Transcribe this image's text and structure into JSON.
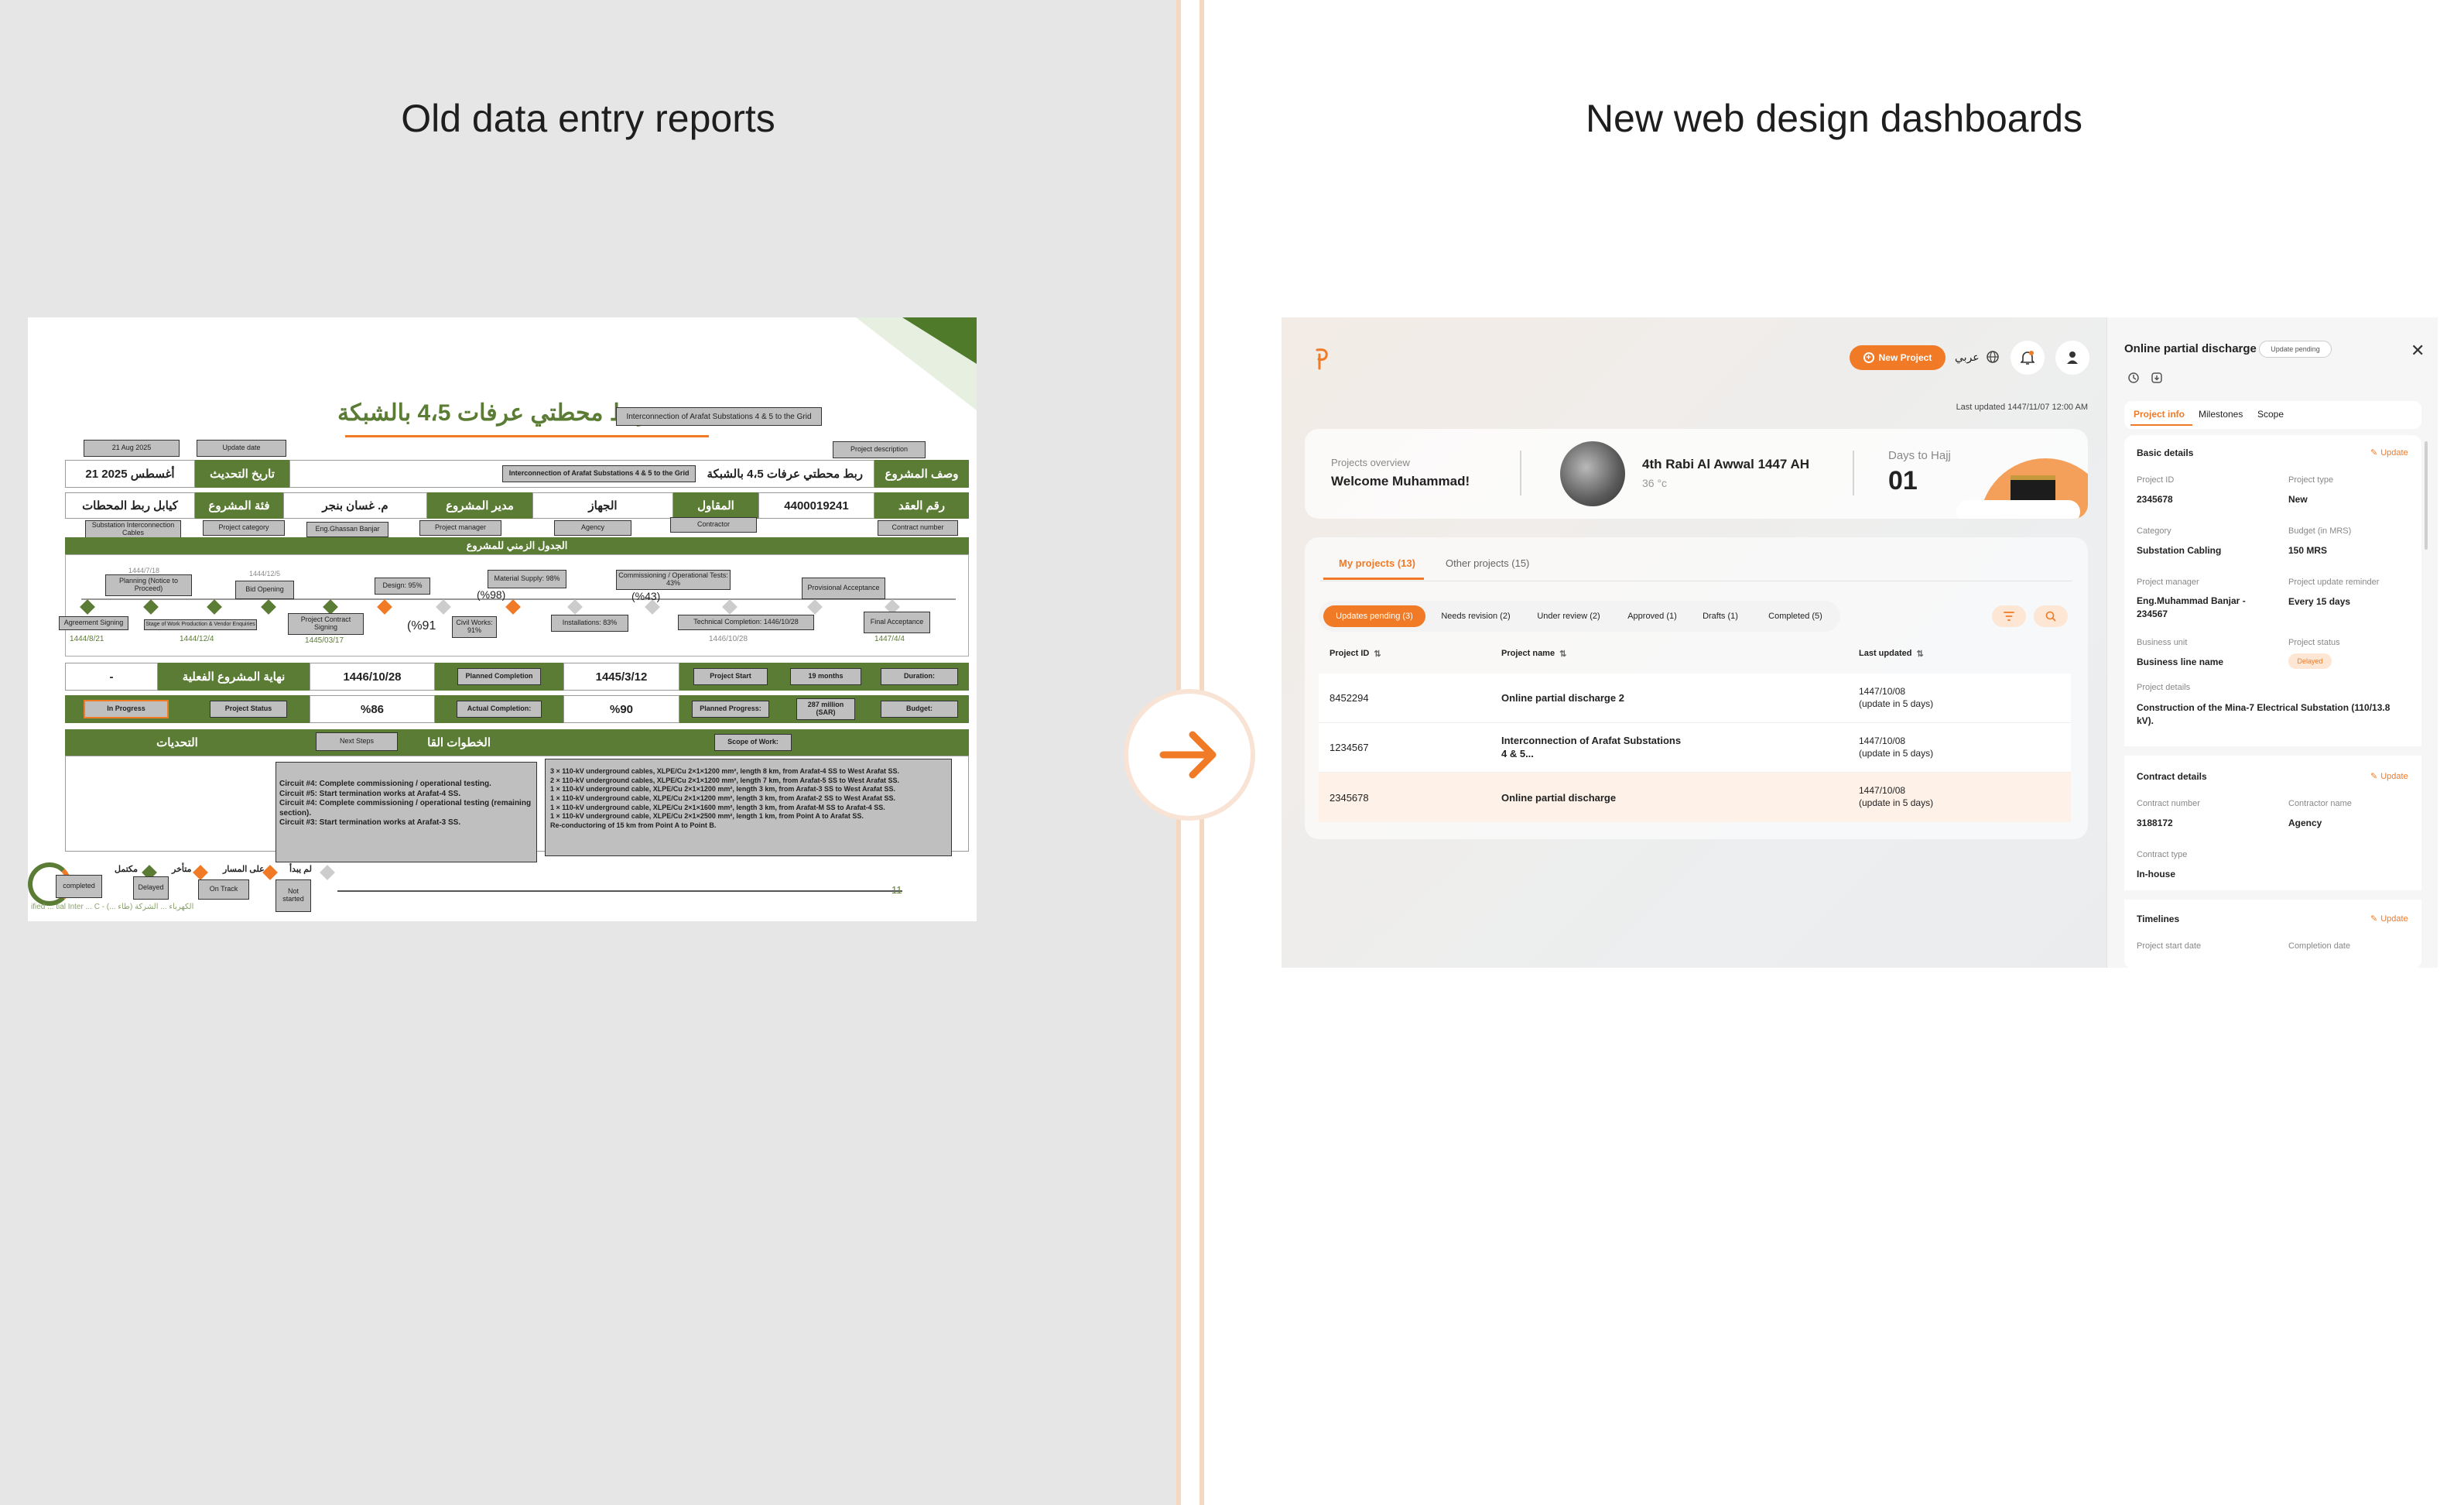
{
  "headings": {
    "left": "Old data entry reports",
    "right": "New web design dashboards"
  },
  "colors": {
    "brand_orange": "#f07a26",
    "report_green": "#5b7c34",
    "divider": "#f6d8c0"
  },
  "old_report": {
    "title_ar": "ربط محطتي عرفات 4،5 بالشبكة",
    "title_en": "Interconnection of Arafat Substations 4 & 5 to the Grid",
    "update_date_en": "21 Aug 2025",
    "update_date_label": "Update date",
    "project_description": "Project description",
    "update_date_ar": "21 أغسطس 2025",
    "update_date_label_ar": "تاريخ التحديث",
    "desc_en": "Interconnection of Arafat Substations 4 & 5 to the Grid",
    "desc_ar": "ربط محطتي عرفات 4،5 بالشبكة",
    "desc_label_ar": "وصف المشروع",
    "category_val_ar": "كيابل ربط المحطات",
    "category_label_ar": "فئة المشروع",
    "manager_val_ar": "م. غسان بنجر",
    "manager_label_ar": "مدير المشروع",
    "agency_val_ar": "الجهاز",
    "contractor_label_ar": "المقاول",
    "contract_no": "4400019241",
    "contract_label_ar": "رقم العقد",
    "substation_cables": "Substation Interconnection Cables",
    "project_category": "Project category",
    "eng_name": "Eng.Ghassan Banjar",
    "project_manager": "Project manager",
    "agency": "Agency",
    "contractor": "Contractor",
    "contract_number": "Contract number",
    "timeline_ar": "الجدول الزمني للمشروع",
    "milestones": [
      {
        "label": "Agreement Signing",
        "date": "1444/8/21"
      },
      {
        "label": "Planning (Notice to Proceed)",
        "date": "1444/7/18"
      },
      {
        "label": "Stage of Work Production & Vendor Enquiries",
        "date": "1444/12/4"
      },
      {
        "label": "Bid Opening",
        "date": "1444/12/5"
      },
      {
        "label": "Project Contract Signing",
        "date": "1445/03/17"
      },
      {
        "label": "Design: 95%",
        "date": ""
      },
      {
        "label": "Civil Works: 91%",
        "date": "(%91"
      },
      {
        "label": "Material Supply: 98%",
        "date": "(%98)"
      },
      {
        "label": "Installations: 83%",
        "date": ""
      },
      {
        "label": "Commissioning / Operational Tests: 43%",
        "date": "(%43)"
      },
      {
        "label": "Technical Completion: 1446/10/28",
        "date": "1446/10/28"
      },
      {
        "label": "Provisional Acceptance",
        "date": ""
      },
      {
        "label": "Final Acceptance",
        "date": "1447/4/4"
      }
    ],
    "actual_end_val": "-",
    "actual_end_label_ar": "نهاية المشروع الفعلية",
    "planned_completion_date": "1446/10/28",
    "planned_completion": "Planned Completion",
    "project_start_date": "1445/3/12",
    "project_start": "Project Start",
    "duration_val": "19 months",
    "duration": "Duration:",
    "status_val": "In Progress",
    "project_status": "Project Status",
    "actual_completion_val": "%86",
    "actual_completion": "Actual Completion:",
    "planned_progress_val": "%90",
    "planned_progress": "Planned Progress:",
    "budget_val": "287 million (SAR)",
    "budget": "Budget:",
    "challenges_ar": "التحديات",
    "next_steps": "Next Steps",
    "next_steps_ar": "الخطوات القا",
    "scope_of_work": "Scope of Work:",
    "next_steps_text": [
      "Circuit #4: Complete commissioning / operational testing.",
      "Circuit #5: Start termination works at Arafat-4 SS.",
      "Circuit #4: Complete commissioning / operational testing (remaining section).",
      "Circuit #3: Start termination works at Arafat-3 SS."
    ],
    "scope_text": [
      "3 × 110-kV underground cables, XLPE/Cu 2×1×1200 mm², length 8 km, from Arafat-4 SS to West Arafat SS.",
      "2 × 110-kV underground cables, XLPE/Cu 2×1×1200 mm², length 7 km, from Arafat-5 SS to West Arafat SS.",
      "1 × 110-kV underground cable, XLPE/Cu 2×1×1200 mm², length 3 km, from Arafat-3 SS to West Arafat SS.",
      "1 × 110-kV underground cable, XLPE/Cu 2×1×1200 mm², length 3 km, from Arafat-2 SS to West Arafat SS.",
      "1 × 110-kV underground cable, XLPE/Cu 2×1×1600 mm², length 3 km, from Arafat-M SS to Arafat-4 SS.",
      "1 × 110-kV underground cable, XLPE/Cu 2×1×2500 mm², length 1 km, from Point A to Arafat SS.",
      "Re-conductoring of 15 km from Point A to Point B."
    ],
    "legend": [
      {
        "ar": "مكتمل",
        "en": "completed"
      },
      {
        "ar": "متأخر",
        "en": "Delayed"
      },
      {
        "ar": "على المسار",
        "en": "On Track"
      },
      {
        "ar": "لم يبدأ",
        "en": "Not started"
      }
    ],
    "page_number": "11",
    "footer": "ified ... tial Inter ... C - (... طاء) الكهرباء ... الشركة"
  },
  "dashboard": {
    "new_project": "New Project",
    "lang": "عربي",
    "last_updated": "Last updated 1447/11/07 12:00 AM",
    "overview_label": "Projects overview",
    "welcome": "Welcome Muhammad!",
    "hijri_date": "4th Rabi Al Awwal 1447 AH",
    "temperature": "36 °c",
    "days_label": "Days to Hajj",
    "days_value": "01",
    "tabs": [
      "My projects (13)",
      "Other projects (15)"
    ],
    "filters": [
      "Updates pending (3)",
      "Needs revision (2)",
      "Under review (2)",
      "Approved (1)",
      "Drafts (1)",
      "Completed (5)"
    ],
    "columns": [
      "Project ID",
      "Project name",
      "Last updated"
    ],
    "rows": [
      {
        "id": "8452294",
        "name": "Online partial discharge 2",
        "date": "1447/10/08",
        "note": "(update in  5 days)"
      },
      {
        "id": "1234567",
        "name": "Interconnection of Arafat Substations 4 & 5...",
        "date": "1447/10/08",
        "note": "(update in  5 days)"
      },
      {
        "id": "2345678",
        "name": "Online partial discharge",
        "date": "1447/10/08",
        "note": "(update in  5 days)"
      }
    ],
    "panel": {
      "title": "Online partial discharge",
      "badge": "Update pending",
      "tabs": [
        "Project info",
        "Milestones",
        "Scope"
      ],
      "update": "Update",
      "basic_title": "Basic details",
      "basic": [
        {
          "label": "Project ID",
          "value": "2345678"
        },
        {
          "label": "Project type",
          "value": "New"
        },
        {
          "label": "Category",
          "value": "Substation Cabling"
        },
        {
          "label": "Budget (in MRS)",
          "value": "150 MRS"
        },
        {
          "label": "Project manager",
          "value": "Eng.Muhammad Banjar - 234567"
        },
        {
          "label": "Project update reminder",
          "value": "Every 15 days"
        },
        {
          "label": "Business unit",
          "value": "Business line name"
        },
        {
          "label": "Project status",
          "value": "Delayed"
        }
      ],
      "details_label": "Project details",
      "details_value": "Construction of the Mina-7 Electrical Substation (110/13.8 kV).",
      "contract_title": "Contract details",
      "contract": [
        {
          "label": "Contract number",
          "value": "3188172"
        },
        {
          "label": "Contractor name",
          "value": "Agency"
        },
        {
          "label": "Contract type",
          "value": "In-house"
        }
      ],
      "timelines_title": "Timelines",
      "timelines": [
        {
          "label": "Project start date"
        },
        {
          "label": "Completion date"
        }
      ]
    }
  }
}
